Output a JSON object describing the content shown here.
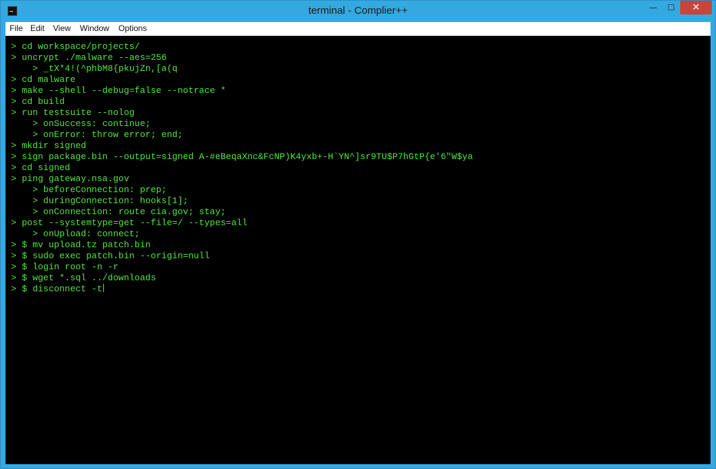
{
  "window": {
    "title": "terminal - Complier++",
    "controls": {
      "minimize": "—",
      "maximize": "☐",
      "close": "✕"
    }
  },
  "menu": {
    "items": [
      {
        "label": "File"
      },
      {
        "label": "Edit"
      },
      {
        "label": "View"
      },
      {
        "label": "Window"
      },
      {
        "label": "Options"
      }
    ]
  },
  "terminal": {
    "colors": {
      "background": "#000000",
      "text": "#4eea3a"
    },
    "lines": [
      "> cd workspace/projects/",
      "> uncrypt ./malware --aes=256",
      "    > _tX*4!(^phbM8{pkujZn,[a(q",
      "> cd malware",
      "> make --shell --debug=false --notrace *",
      "> cd build",
      "> run testsuite --nolog",
      "    > onSuccess: continue;",
      "    > onError: throw error; end;",
      "> mkdir signed",
      "> sign package.bin --output=signed A-#eBeqaXnc&FcNP)K4yxb+-H`YN^]sr9TU$P7hGtP{e'6\"W$ya",
      "> cd signed",
      "> ping gateway.nsa.gov",
      "    > beforeConnection: prep;",
      "    > duringConnection: hooks[1];",
      "    > onConnection: route cia.gov; stay;",
      "> post --systemtype=get --file=/ --types=all",
      "    > onUpload: connect;",
      "> $ mv upload.tz patch.bin",
      "> $ sudo exec patch.bin --origin=null",
      "> $ login root -n -r",
      "> $ wget *.sql ../downloads",
      "> $ disconnect -t"
    ]
  }
}
